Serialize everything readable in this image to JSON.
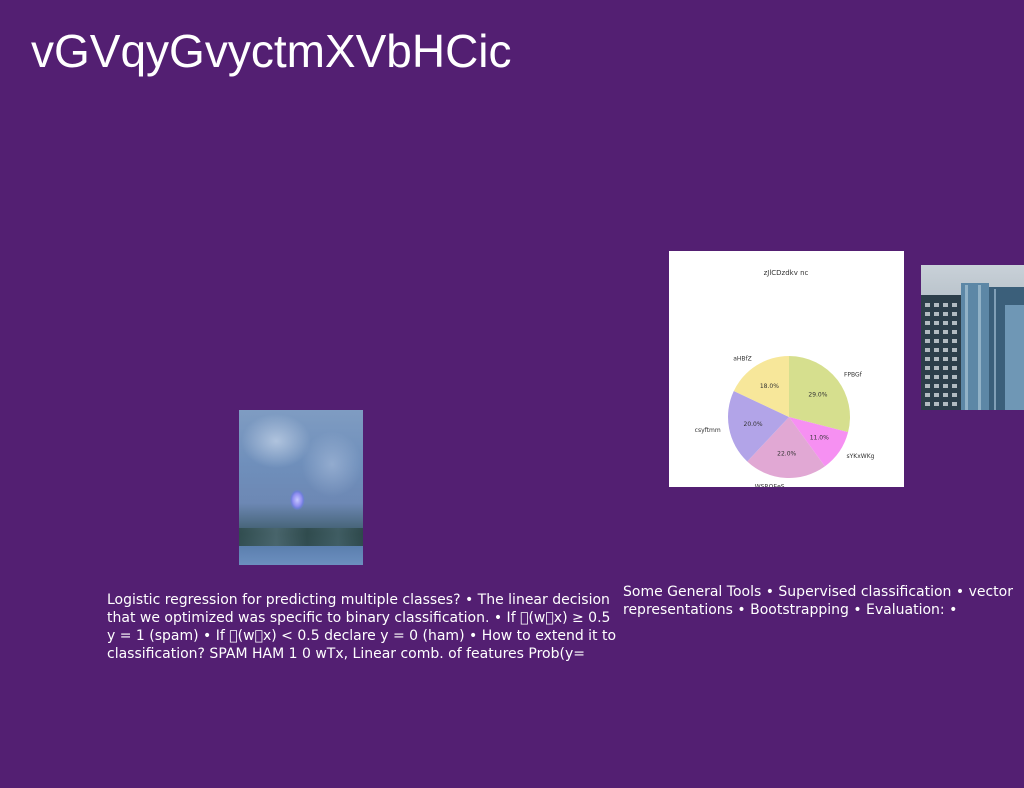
{
  "slide": {
    "title": "vGVqyGvyctmXVbHCic",
    "background_color": "#531f72"
  },
  "text_left": {
    "content": "Logistic regression for predicting multiple classes? • The linear decision that we optimized was specific to binary classification. • If \u0000(w\u0000x) ≥ 0.5 y = 1 (spam) • If \u0000(w\u0000x) < 0.5 declare y = 0 (ham) • How to extend it to classification? SPAM HAM 1 0 wTx, Linear comb. of features Prob(y="
  },
  "text_right": {
    "content": "Some General Tools • Supervised classification • vector representations • Bootstrapping • Evaluation: •"
  },
  "chart_data": {
    "type": "pie",
    "title": "zJlCDzdkv nc",
    "slices": [
      {
        "label": "FPBGf",
        "value": 29.0,
        "pct_label": "29.0%",
        "color": "#d6df8e"
      },
      {
        "label": "sYKxWKg",
        "value": 11.0,
        "pct_label": "11.0%",
        "color": "#f690f2"
      },
      {
        "label": "WSRQEeS",
        "value": 22.0,
        "pct_label": "22.0%",
        "color": "#e1a8d4"
      },
      {
        "label": "csyftmm",
        "value": 20.0,
        "pct_label": "20.0%",
        "color": "#b2a4e8"
      },
      {
        "label": "aHBfZ",
        "value": 18.0,
        "pct_label": "18.0%",
        "color": "#f7e79a"
      }
    ],
    "start_angle_deg": 90,
    "direction": "clockwise"
  }
}
